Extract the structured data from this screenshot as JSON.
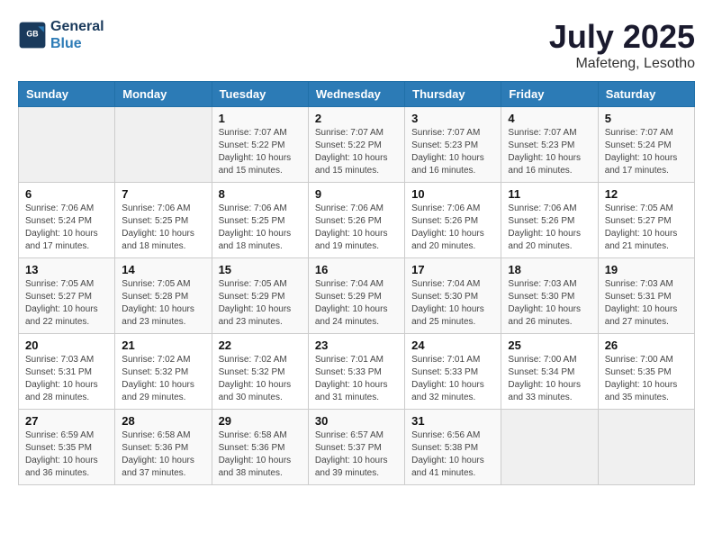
{
  "header": {
    "logo_line1": "General",
    "logo_line2": "Blue",
    "month": "July 2025",
    "location": "Mafeteng, Lesotho"
  },
  "weekdays": [
    "Sunday",
    "Monday",
    "Tuesday",
    "Wednesday",
    "Thursday",
    "Friday",
    "Saturday"
  ],
  "weeks": [
    [
      {
        "day": "",
        "info": ""
      },
      {
        "day": "",
        "info": ""
      },
      {
        "day": "1",
        "info": "Sunrise: 7:07 AM\nSunset: 5:22 PM\nDaylight: 10 hours\nand 15 minutes."
      },
      {
        "day": "2",
        "info": "Sunrise: 7:07 AM\nSunset: 5:22 PM\nDaylight: 10 hours\nand 15 minutes."
      },
      {
        "day": "3",
        "info": "Sunrise: 7:07 AM\nSunset: 5:23 PM\nDaylight: 10 hours\nand 16 minutes."
      },
      {
        "day": "4",
        "info": "Sunrise: 7:07 AM\nSunset: 5:23 PM\nDaylight: 10 hours\nand 16 minutes."
      },
      {
        "day": "5",
        "info": "Sunrise: 7:07 AM\nSunset: 5:24 PM\nDaylight: 10 hours\nand 17 minutes."
      }
    ],
    [
      {
        "day": "6",
        "info": "Sunrise: 7:06 AM\nSunset: 5:24 PM\nDaylight: 10 hours\nand 17 minutes."
      },
      {
        "day": "7",
        "info": "Sunrise: 7:06 AM\nSunset: 5:25 PM\nDaylight: 10 hours\nand 18 minutes."
      },
      {
        "day": "8",
        "info": "Sunrise: 7:06 AM\nSunset: 5:25 PM\nDaylight: 10 hours\nand 18 minutes."
      },
      {
        "day": "9",
        "info": "Sunrise: 7:06 AM\nSunset: 5:26 PM\nDaylight: 10 hours\nand 19 minutes."
      },
      {
        "day": "10",
        "info": "Sunrise: 7:06 AM\nSunset: 5:26 PM\nDaylight: 10 hours\nand 20 minutes."
      },
      {
        "day": "11",
        "info": "Sunrise: 7:06 AM\nSunset: 5:26 PM\nDaylight: 10 hours\nand 20 minutes."
      },
      {
        "day": "12",
        "info": "Sunrise: 7:05 AM\nSunset: 5:27 PM\nDaylight: 10 hours\nand 21 minutes."
      }
    ],
    [
      {
        "day": "13",
        "info": "Sunrise: 7:05 AM\nSunset: 5:27 PM\nDaylight: 10 hours\nand 22 minutes."
      },
      {
        "day": "14",
        "info": "Sunrise: 7:05 AM\nSunset: 5:28 PM\nDaylight: 10 hours\nand 23 minutes."
      },
      {
        "day": "15",
        "info": "Sunrise: 7:05 AM\nSunset: 5:29 PM\nDaylight: 10 hours\nand 23 minutes."
      },
      {
        "day": "16",
        "info": "Sunrise: 7:04 AM\nSunset: 5:29 PM\nDaylight: 10 hours\nand 24 minutes."
      },
      {
        "day": "17",
        "info": "Sunrise: 7:04 AM\nSunset: 5:30 PM\nDaylight: 10 hours\nand 25 minutes."
      },
      {
        "day": "18",
        "info": "Sunrise: 7:03 AM\nSunset: 5:30 PM\nDaylight: 10 hours\nand 26 minutes."
      },
      {
        "day": "19",
        "info": "Sunrise: 7:03 AM\nSunset: 5:31 PM\nDaylight: 10 hours\nand 27 minutes."
      }
    ],
    [
      {
        "day": "20",
        "info": "Sunrise: 7:03 AM\nSunset: 5:31 PM\nDaylight: 10 hours\nand 28 minutes."
      },
      {
        "day": "21",
        "info": "Sunrise: 7:02 AM\nSunset: 5:32 PM\nDaylight: 10 hours\nand 29 minutes."
      },
      {
        "day": "22",
        "info": "Sunrise: 7:02 AM\nSunset: 5:32 PM\nDaylight: 10 hours\nand 30 minutes."
      },
      {
        "day": "23",
        "info": "Sunrise: 7:01 AM\nSunset: 5:33 PM\nDaylight: 10 hours\nand 31 minutes."
      },
      {
        "day": "24",
        "info": "Sunrise: 7:01 AM\nSunset: 5:33 PM\nDaylight: 10 hours\nand 32 minutes."
      },
      {
        "day": "25",
        "info": "Sunrise: 7:00 AM\nSunset: 5:34 PM\nDaylight: 10 hours\nand 33 minutes."
      },
      {
        "day": "26",
        "info": "Sunrise: 7:00 AM\nSunset: 5:35 PM\nDaylight: 10 hours\nand 35 minutes."
      }
    ],
    [
      {
        "day": "27",
        "info": "Sunrise: 6:59 AM\nSunset: 5:35 PM\nDaylight: 10 hours\nand 36 minutes."
      },
      {
        "day": "28",
        "info": "Sunrise: 6:58 AM\nSunset: 5:36 PM\nDaylight: 10 hours\nand 37 minutes."
      },
      {
        "day": "29",
        "info": "Sunrise: 6:58 AM\nSunset: 5:36 PM\nDaylight: 10 hours\nand 38 minutes."
      },
      {
        "day": "30",
        "info": "Sunrise: 6:57 AM\nSunset: 5:37 PM\nDaylight: 10 hours\nand 39 minutes."
      },
      {
        "day": "31",
        "info": "Sunrise: 6:56 AM\nSunset: 5:38 PM\nDaylight: 10 hours\nand 41 minutes."
      },
      {
        "day": "",
        "info": ""
      },
      {
        "day": "",
        "info": ""
      }
    ]
  ]
}
